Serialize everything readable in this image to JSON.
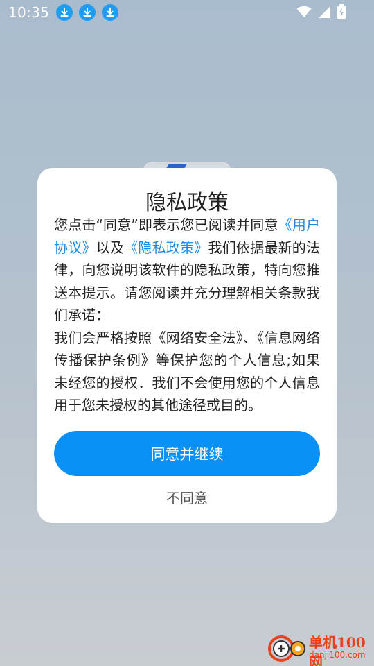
{
  "status_bar": {
    "time": "10:35",
    "notification_icons": [
      "download-icon",
      "download-icon",
      "download-icon"
    ],
    "right_icons": [
      "wifi-icon",
      "signal-icon",
      "battery-charging-icon"
    ]
  },
  "dialog": {
    "title": "隐私政策",
    "body": {
      "seg1": "您点击“同意”即表示您已阅读并同意",
      "link1": "《用户协议》",
      "seg2": "以及",
      "link2": "《隐私政策》",
      "seg3": "我们依据最新的法律，向您说明该软件的隐私政策，特向您推送本提示。请您阅读并充分理解相关条款我们承诺：",
      "seg4": "我们会严格按照《网络安全法》、《信息网络传播保护条例》等保护您的个人信息;如果未经您的授权．我们不会使用您的个人信息用于您未授权的其他途径或目的。"
    },
    "agree_label": "同意并继续",
    "disagree_label": "不同意"
  },
  "watermark": {
    "name": "单机100网",
    "url": "danji100.com"
  },
  "colors": {
    "link": "#1f8ae6",
    "button": "#0b91f5",
    "download_badge": "#1e9df2",
    "watermark": "#e8431b"
  }
}
